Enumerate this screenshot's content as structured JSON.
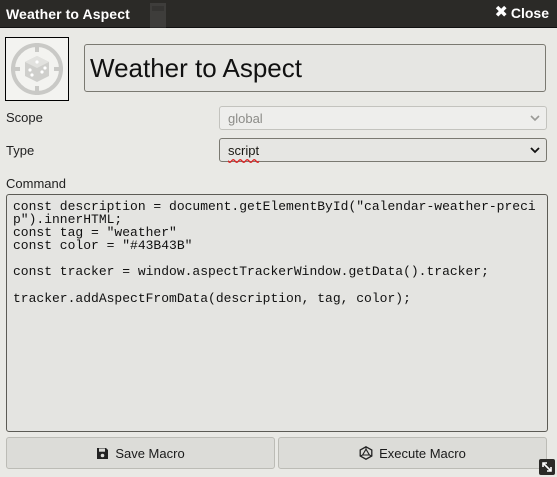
{
  "window": {
    "title": "Weather to Aspect",
    "close_label": "Close"
  },
  "macro": {
    "name": "Weather to Aspect"
  },
  "fields": {
    "scope": {
      "label": "Scope",
      "value": "global",
      "disabled": true
    },
    "type": {
      "label": "Type",
      "value": "script"
    },
    "command_label": "Command"
  },
  "command": {
    "code": "const description = document.getElementById(\"calendar-weather-precip\").innerHTML;\nconst tag = \"weather\"\nconst color = \"#43B43B\"\n\nconst tracker = window.aspectTrackerWindow.getData().tracker;\n\ntracker.addAspectFromData(description, tag, color);"
  },
  "buttons": {
    "save": {
      "label": "Save Macro",
      "icon": "floppy-disk-icon"
    },
    "execute": {
      "label": "Execute Macro",
      "icon": "d20-dice-icon"
    }
  },
  "icons": {
    "macro_image": "dice-icon",
    "close": "close-icon",
    "resize": "resize-handle-icon"
  },
  "colors": {
    "titlebar": "#2b2a27",
    "background": "#e9e9e5"
  }
}
